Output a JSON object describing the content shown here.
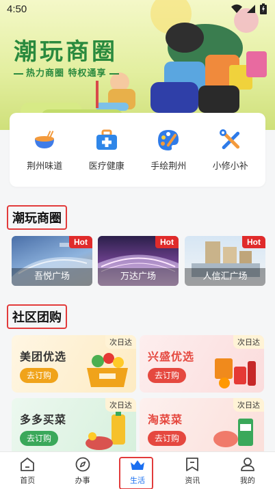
{
  "status_bar": {
    "time": "4:50"
  },
  "hero": {
    "title": "潮玩商圈",
    "subtitle": "热力商圈 特权通享"
  },
  "quick_entries": [
    {
      "label": "荆州味道",
      "icon": "bowl-icon"
    },
    {
      "label": "医疗健康",
      "icon": "medical-kit-icon"
    },
    {
      "label": "手绘荆州",
      "icon": "palette-icon"
    },
    {
      "label": "小修小补",
      "icon": "tools-icon"
    }
  ],
  "malls_section": {
    "title": "潮玩商圈",
    "items": [
      {
        "name": "吾悦广场",
        "badge": "Hot"
      },
      {
        "name": "万达广场",
        "badge": "Hot"
      },
      {
        "name": "人信汇广场",
        "badge": "Hot"
      }
    ]
  },
  "group_section": {
    "title": "社区团购",
    "items": [
      {
        "name": "美团优选",
        "button": "去订购",
        "tag": "次日达",
        "accent": "#f0a31a"
      },
      {
        "name": "兴盛优选",
        "button": "去订购",
        "tag": "次日达",
        "accent": "#e5483f"
      },
      {
        "name": "多多买菜",
        "button": "去订购",
        "tag": "次日达",
        "accent": "#3aa85a"
      },
      {
        "name": "淘菜菜",
        "button": "去订购",
        "tag": "次日达",
        "accent": "#e5483f"
      }
    ]
  },
  "bottom_nav": {
    "items": [
      {
        "label": "首页",
        "icon": "home-icon"
      },
      {
        "label": "办事",
        "icon": "compass-icon"
      },
      {
        "label": "生活",
        "icon": "crown-basket-icon",
        "active": true
      },
      {
        "label": "资讯",
        "icon": "bookmark-icon"
      },
      {
        "label": "我的",
        "icon": "person-icon"
      }
    ]
  },
  "colors": {
    "accent_blue": "#1a6ff0",
    "highlight_red": "#e23a3a",
    "hero_green": "#2a8a3e"
  }
}
